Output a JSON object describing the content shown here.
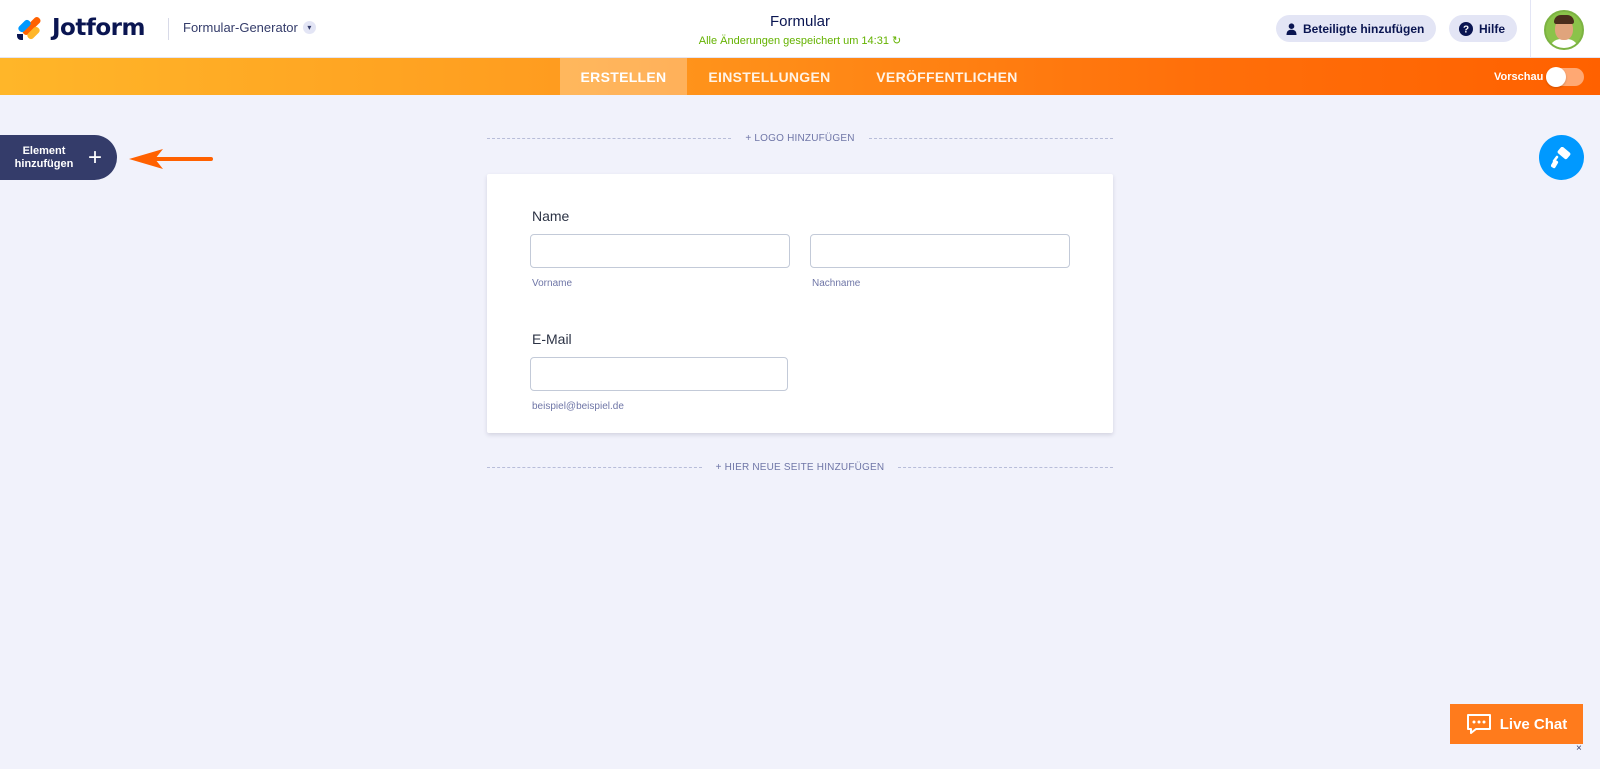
{
  "header": {
    "brand": "Jotform",
    "generator_label": "Formular-Generator",
    "title": "Formular",
    "save_status": "Alle Änderungen gespeichert um 14:31",
    "participants_label": "Beteiligte hinzufügen",
    "help_label": "Hilfe"
  },
  "nav": {
    "tabs": [
      "ERSTELLEN",
      "EINSTELLUNGEN",
      "VERÖFFENTLICHEN"
    ],
    "active_tab": "ERSTELLEN",
    "preview_label": "Vorschau",
    "preview_on": false
  },
  "sidebar": {
    "add_element_line1": "Element",
    "add_element_line2": "hinzufügen",
    "add_icon": "+"
  },
  "form": {
    "logo_link": "+ LOGO HINZUFÜGEN",
    "new_page_link": "+ HIER NEUE SEITE HINZUFÜGEN",
    "name_label": "Name",
    "firstname_sublabel": "Vorname",
    "lastname_sublabel": "Nachname",
    "email_label": "E-Mail",
    "email_sublabel": "beispiel@beispiel.de",
    "firstname_value": "",
    "lastname_value": "",
    "email_value": ""
  },
  "chat": {
    "label": "Live Chat",
    "close": "×"
  },
  "colors": {
    "accent_orange": "#ff6100",
    "nav_gradient_start": "#ffb629",
    "primary_blue": "#0099ff",
    "navy": "#0a1551",
    "saved_green": "#64b200",
    "canvas": "#f1f2fb"
  },
  "icons": {
    "logo": "jotform-logo-icon",
    "chevron": "chevron-down-icon",
    "participants": "user-icon",
    "help": "question-circle-icon",
    "refresh": "refresh-icon",
    "design": "paint-roller-icon",
    "chat": "chat-bubble-icon",
    "arrow": "arrow-left-icon"
  }
}
